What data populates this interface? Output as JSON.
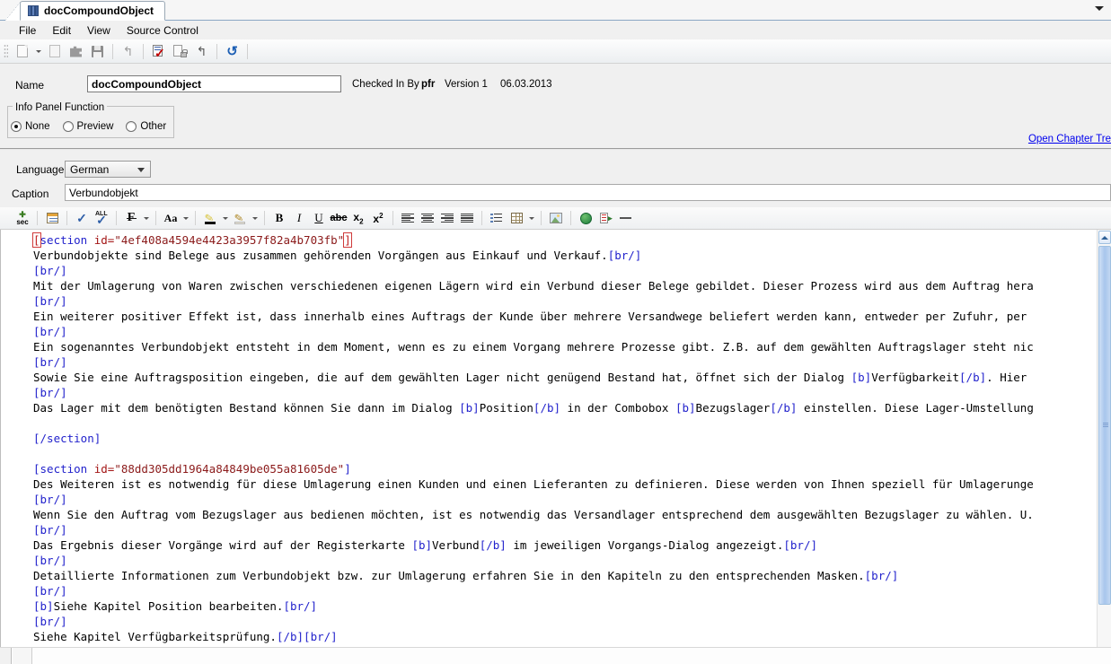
{
  "window": {
    "tab_title": "docCompoundObject",
    "tab_icon": "books-icon",
    "tabstrip_dropdown_icon": "chevron-down-icon"
  },
  "menubar": {
    "items": [
      {
        "label": "File"
      },
      {
        "label": "Edit"
      },
      {
        "label": "View"
      },
      {
        "label": "Source Control"
      }
    ]
  },
  "main_toolbar": {
    "buttons": [
      {
        "name": "new-document-icon",
        "tooltip": "New"
      },
      {
        "name": "new-document-dropdown-icon",
        "tooltip": "New dropdown"
      },
      {
        "name": "copy-icon",
        "tooltip": "Copy"
      },
      {
        "name": "plugin-icon",
        "tooltip": "Add-in"
      },
      {
        "name": "save-icon",
        "tooltip": "Save"
      },
      {
        "name": "undo-icon",
        "tooltip": "Undo"
      },
      {
        "name": "check-in-icon",
        "tooltip": "Check In"
      },
      {
        "name": "check-out-icon",
        "tooltip": "Check Out"
      },
      {
        "name": "undo-checkout-icon",
        "tooltip": "Undo Check Out"
      },
      {
        "name": "refresh-icon",
        "tooltip": "Refresh"
      }
    ]
  },
  "form": {
    "name_label": "Name",
    "name_value": "docCompoundObject",
    "checked_in_by_label": "Checked In By",
    "checked_in_by_user": "pfr",
    "version_label": "Version 1",
    "date": "06.03.2013",
    "open_chapter_link": "Open Chapter Tre"
  },
  "info_panel": {
    "title": "Info Panel Function",
    "options": [
      {
        "label": "None",
        "selected": true
      },
      {
        "label": "Preview",
        "selected": false
      },
      {
        "label": "Other",
        "selected": false
      }
    ]
  },
  "language_row": {
    "label": "Language",
    "value": "German",
    "dropdown_icon": "chevron-down-icon"
  },
  "caption_row": {
    "label": "Caption",
    "value": "Verbundobjekt"
  },
  "editor_toolbar": {
    "buttons": [
      {
        "name": "insert-section-icon",
        "tooltip": "Insert Section"
      },
      {
        "name": "info-panel-icon",
        "tooltip": "Info Panel"
      },
      {
        "name": "spellcheck-icon",
        "tooltip": "Spell Check"
      },
      {
        "name": "spellcheck-all-icon",
        "tooltip": "Spell Check All"
      },
      {
        "name": "font-icon",
        "tooltip": "Font"
      },
      {
        "name": "font-dropdown-icon",
        "tooltip": "Font dropdown"
      },
      {
        "name": "font-size-icon",
        "tooltip": "Font Size"
      },
      {
        "name": "font-size-dropdown-icon",
        "tooltip": "Font Size dropdown"
      },
      {
        "name": "text-color-icon",
        "tooltip": "Text Color"
      },
      {
        "name": "text-color-dropdown-icon",
        "tooltip": "Text Color dropdown"
      },
      {
        "name": "highlight-color-icon",
        "tooltip": "Highlight Color"
      },
      {
        "name": "highlight-color-dropdown-icon",
        "tooltip": "Highlight dropdown"
      },
      {
        "name": "bold-icon",
        "tooltip": "Bold",
        "glyph": "B"
      },
      {
        "name": "italic-icon",
        "tooltip": "Italic",
        "glyph": "I"
      },
      {
        "name": "underline-icon",
        "tooltip": "Underline",
        "glyph": "U"
      },
      {
        "name": "strikethrough-icon",
        "tooltip": "Strikethrough",
        "glyph": "abc"
      },
      {
        "name": "subscript-icon",
        "tooltip": "Subscript",
        "glyph": "x"
      },
      {
        "name": "superscript-icon",
        "tooltip": "Superscript",
        "glyph": "x"
      },
      {
        "name": "align-left-icon",
        "tooltip": "Align Left"
      },
      {
        "name": "align-center-icon",
        "tooltip": "Align Center"
      },
      {
        "name": "align-right-icon",
        "tooltip": "Align Right"
      },
      {
        "name": "align-justify-icon",
        "tooltip": "Justify"
      },
      {
        "name": "bullet-list-icon",
        "tooltip": "Bullet List"
      },
      {
        "name": "insert-table-icon",
        "tooltip": "Insert Table"
      },
      {
        "name": "insert-table-dropdown-icon",
        "tooltip": "Table dropdown"
      },
      {
        "name": "insert-image-icon",
        "tooltip": "Insert Image"
      },
      {
        "name": "insert-hyperlink-icon",
        "tooltip": "Insert Hyperlink"
      },
      {
        "name": "insert-reference-icon",
        "tooltip": "Insert Reference"
      },
      {
        "name": "insert-horizontal-rule-icon",
        "tooltip": "Horizontal Rule"
      }
    ]
  },
  "editor": {
    "scrollbar": {
      "up_arrow_icon": "chevron-up-icon"
    },
    "lines": [
      {
        "id": "l1",
        "segments": [
          {
            "t": "[",
            "c": "tagr",
            "boxed": true
          },
          {
            "t": "section",
            "c": "tagb"
          },
          {
            "t": " ",
            "c": ""
          },
          {
            "t": "id=",
            "c": "attr"
          },
          {
            "t": "\"4ef408a4594e4423a3957f82a4b703fb\"",
            "c": "val"
          },
          {
            "t": "]",
            "c": "tagr",
            "boxed": true
          }
        ]
      },
      {
        "id": "l2",
        "segments": [
          {
            "t": "Verbundobjekte sind Belege aus zusammen gehörenden Vorgängen aus Einkauf und Verkauf.",
            "c": ""
          },
          {
            "t": "[br/]",
            "c": "tagb"
          }
        ]
      },
      {
        "id": "l3",
        "segments": [
          {
            "t": "[br/]",
            "c": "tagb"
          }
        ]
      },
      {
        "id": "l4",
        "segments": [
          {
            "t": "Mit der Umlagerung von Waren zwischen verschiedenen eigenen Lägern wird ein Verbund dieser Belege gebildet. Dieser Prozess wird aus dem Auftrag hera",
            "c": ""
          }
        ]
      },
      {
        "id": "l5",
        "segments": [
          {
            "t": "[br/]",
            "c": "tagb"
          }
        ]
      },
      {
        "id": "l6",
        "segments": [
          {
            "t": "Ein weiterer positiver Effekt ist, dass innerhalb eines Auftrags der Kunde über mehrere Versandwege beliefert werden kann, entweder per Zufuhr, per",
            "c": ""
          }
        ]
      },
      {
        "id": "l7",
        "segments": [
          {
            "t": "[br/]",
            "c": "tagb"
          }
        ]
      },
      {
        "id": "l8",
        "segments": [
          {
            "t": "Ein sogenanntes Verbundobjekt entsteht in dem Moment, wenn es zu einem Vorgang mehrere Prozesse gibt. Z.B. auf dem gewählten Auftragslager steht nic",
            "c": ""
          }
        ]
      },
      {
        "id": "l9",
        "segments": [
          {
            "t": "[br/]",
            "c": "tagb"
          }
        ]
      },
      {
        "id": "l10",
        "segments": [
          {
            "t": "Sowie Sie eine Auftragsposition eingeben, die auf dem gewählten Lager nicht genügend Bestand hat, öffnet sich der Dialog ",
            "c": ""
          },
          {
            "t": "[b]",
            "c": "tagb"
          },
          {
            "t": "Verfügbarkeit",
            "c": ""
          },
          {
            "t": "[/b]",
            "c": "tagb"
          },
          {
            "t": ". Hier",
            "c": ""
          }
        ]
      },
      {
        "id": "l11",
        "segments": [
          {
            "t": "[br/]",
            "c": "tagb"
          }
        ]
      },
      {
        "id": "l12",
        "segments": [
          {
            "t": "Das Lager mit dem benötigten Bestand können Sie dann im Dialog ",
            "c": ""
          },
          {
            "t": "[b]",
            "c": "tagb"
          },
          {
            "t": "Position",
            "c": ""
          },
          {
            "t": "[/b]",
            "c": "tagb"
          },
          {
            "t": " in der Combobox ",
            "c": ""
          },
          {
            "t": "[b]",
            "c": "tagb"
          },
          {
            "t": "Bezugslager",
            "c": ""
          },
          {
            "t": "[/b]",
            "c": "tagb"
          },
          {
            "t": " einstellen. Diese Lager-Umstellung",
            "c": ""
          }
        ]
      },
      {
        "id": "l13",
        "segments": [
          {
            "t": "",
            "c": ""
          }
        ]
      },
      {
        "id": "l14",
        "segments": [
          {
            "t": "[/section]",
            "c": "tagb"
          }
        ]
      },
      {
        "id": "l15",
        "segments": [
          {
            "t": "",
            "c": ""
          }
        ]
      },
      {
        "id": "l16",
        "segments": [
          {
            "t": "[",
            "c": "tagb"
          },
          {
            "t": "section",
            "c": "tagb"
          },
          {
            "t": " ",
            "c": ""
          },
          {
            "t": "id=",
            "c": "attr"
          },
          {
            "t": "\"88dd305dd1964a84849be055a81605de\"",
            "c": "val"
          },
          {
            "t": "]",
            "c": "tagb"
          }
        ]
      },
      {
        "id": "l17",
        "segments": [
          {
            "t": "Des Weiteren ist es notwendig für diese Umlagerung einen Kunden und einen Lieferanten zu definieren. Diese werden von Ihnen speziell für Umlagerunge",
            "c": ""
          }
        ]
      },
      {
        "id": "l18",
        "segments": [
          {
            "t": "[br/]",
            "c": "tagb"
          }
        ]
      },
      {
        "id": "l19",
        "segments": [
          {
            "t": "Wenn Sie den Auftrag vom Bezugslager aus bedienen möchten, ist es notwendig das Versandlager entsprechend dem ausgewählten Bezugslager zu wählen. U.",
            "c": ""
          }
        ]
      },
      {
        "id": "l20",
        "segments": [
          {
            "t": "[br/]",
            "c": "tagb"
          }
        ]
      },
      {
        "id": "l21",
        "segments": [
          {
            "t": "Das Ergebnis dieser Vorgänge wird auf der Registerkarte ",
            "c": ""
          },
          {
            "t": "[b]",
            "c": "tagb"
          },
          {
            "t": "Verbund",
            "c": ""
          },
          {
            "t": "[/b]",
            "c": "tagb"
          },
          {
            "t": " im jeweiligen Vorgangs-Dialog angezeigt.",
            "c": ""
          },
          {
            "t": "[br/]",
            "c": "tagb"
          }
        ]
      },
      {
        "id": "l22",
        "segments": [
          {
            "t": "[br/]",
            "c": "tagb"
          }
        ]
      },
      {
        "id": "l23",
        "segments": [
          {
            "t": "Detaillierte Informationen zum Verbundobjekt bzw. zur Umlagerung erfahren Sie in den Kapiteln zu den entsprechenden Masken.",
            "c": ""
          },
          {
            "t": "[br/]",
            "c": "tagb"
          }
        ]
      },
      {
        "id": "l24",
        "segments": [
          {
            "t": "[br/]",
            "c": "tagb"
          }
        ]
      },
      {
        "id": "l25",
        "segments": [
          {
            "t": "[b]",
            "c": "tagb"
          },
          {
            "t": "Siehe Kapitel Position bearbeiten.",
            "c": ""
          },
          {
            "t": "[br/]",
            "c": "tagb"
          }
        ]
      },
      {
        "id": "l26",
        "segments": [
          {
            "t": "[br/]",
            "c": "tagb"
          }
        ]
      },
      {
        "id": "l27",
        "segments": [
          {
            "t": "Siehe Kapitel Verfügbarkeitsprüfung.",
            "c": ""
          },
          {
            "t": "[/b]",
            "c": "tagb"
          },
          {
            "t": "[br/]",
            "c": "tagb"
          }
        ]
      }
    ]
  },
  "colors": {
    "tag_blue": "#2222cc",
    "bracket_red": "#c02020",
    "attr_value": "#8b1a1a",
    "link_blue": "#0000ee",
    "chrome": "#f0f0f0",
    "scroll_thumb": "#a8c6ec"
  }
}
